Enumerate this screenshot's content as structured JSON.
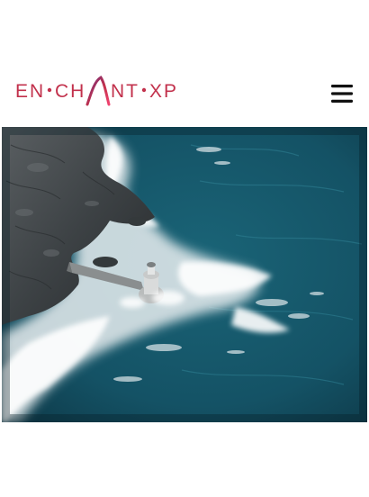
{
  "brand": {
    "name": "ENCHANTXP",
    "logo_text": {
      "part1": "EN",
      "part2": "CH",
      "part3": "NT",
      "part4": "XP"
    },
    "colors": {
      "text": "#c2314c",
      "accent_a": "#6f2e7d",
      "accent_b": "#f1426f"
    }
  },
  "header": {
    "menu_icon": "hamburger-menu-icon"
  },
  "hero": {
    "image_subject": "aerial-lighthouse-on-rocky-coast",
    "colors": {
      "sea_dark": "#0b2d3a",
      "sea": "#145265",
      "foam": "#e8eef0",
      "rock": "#3d4245"
    }
  }
}
